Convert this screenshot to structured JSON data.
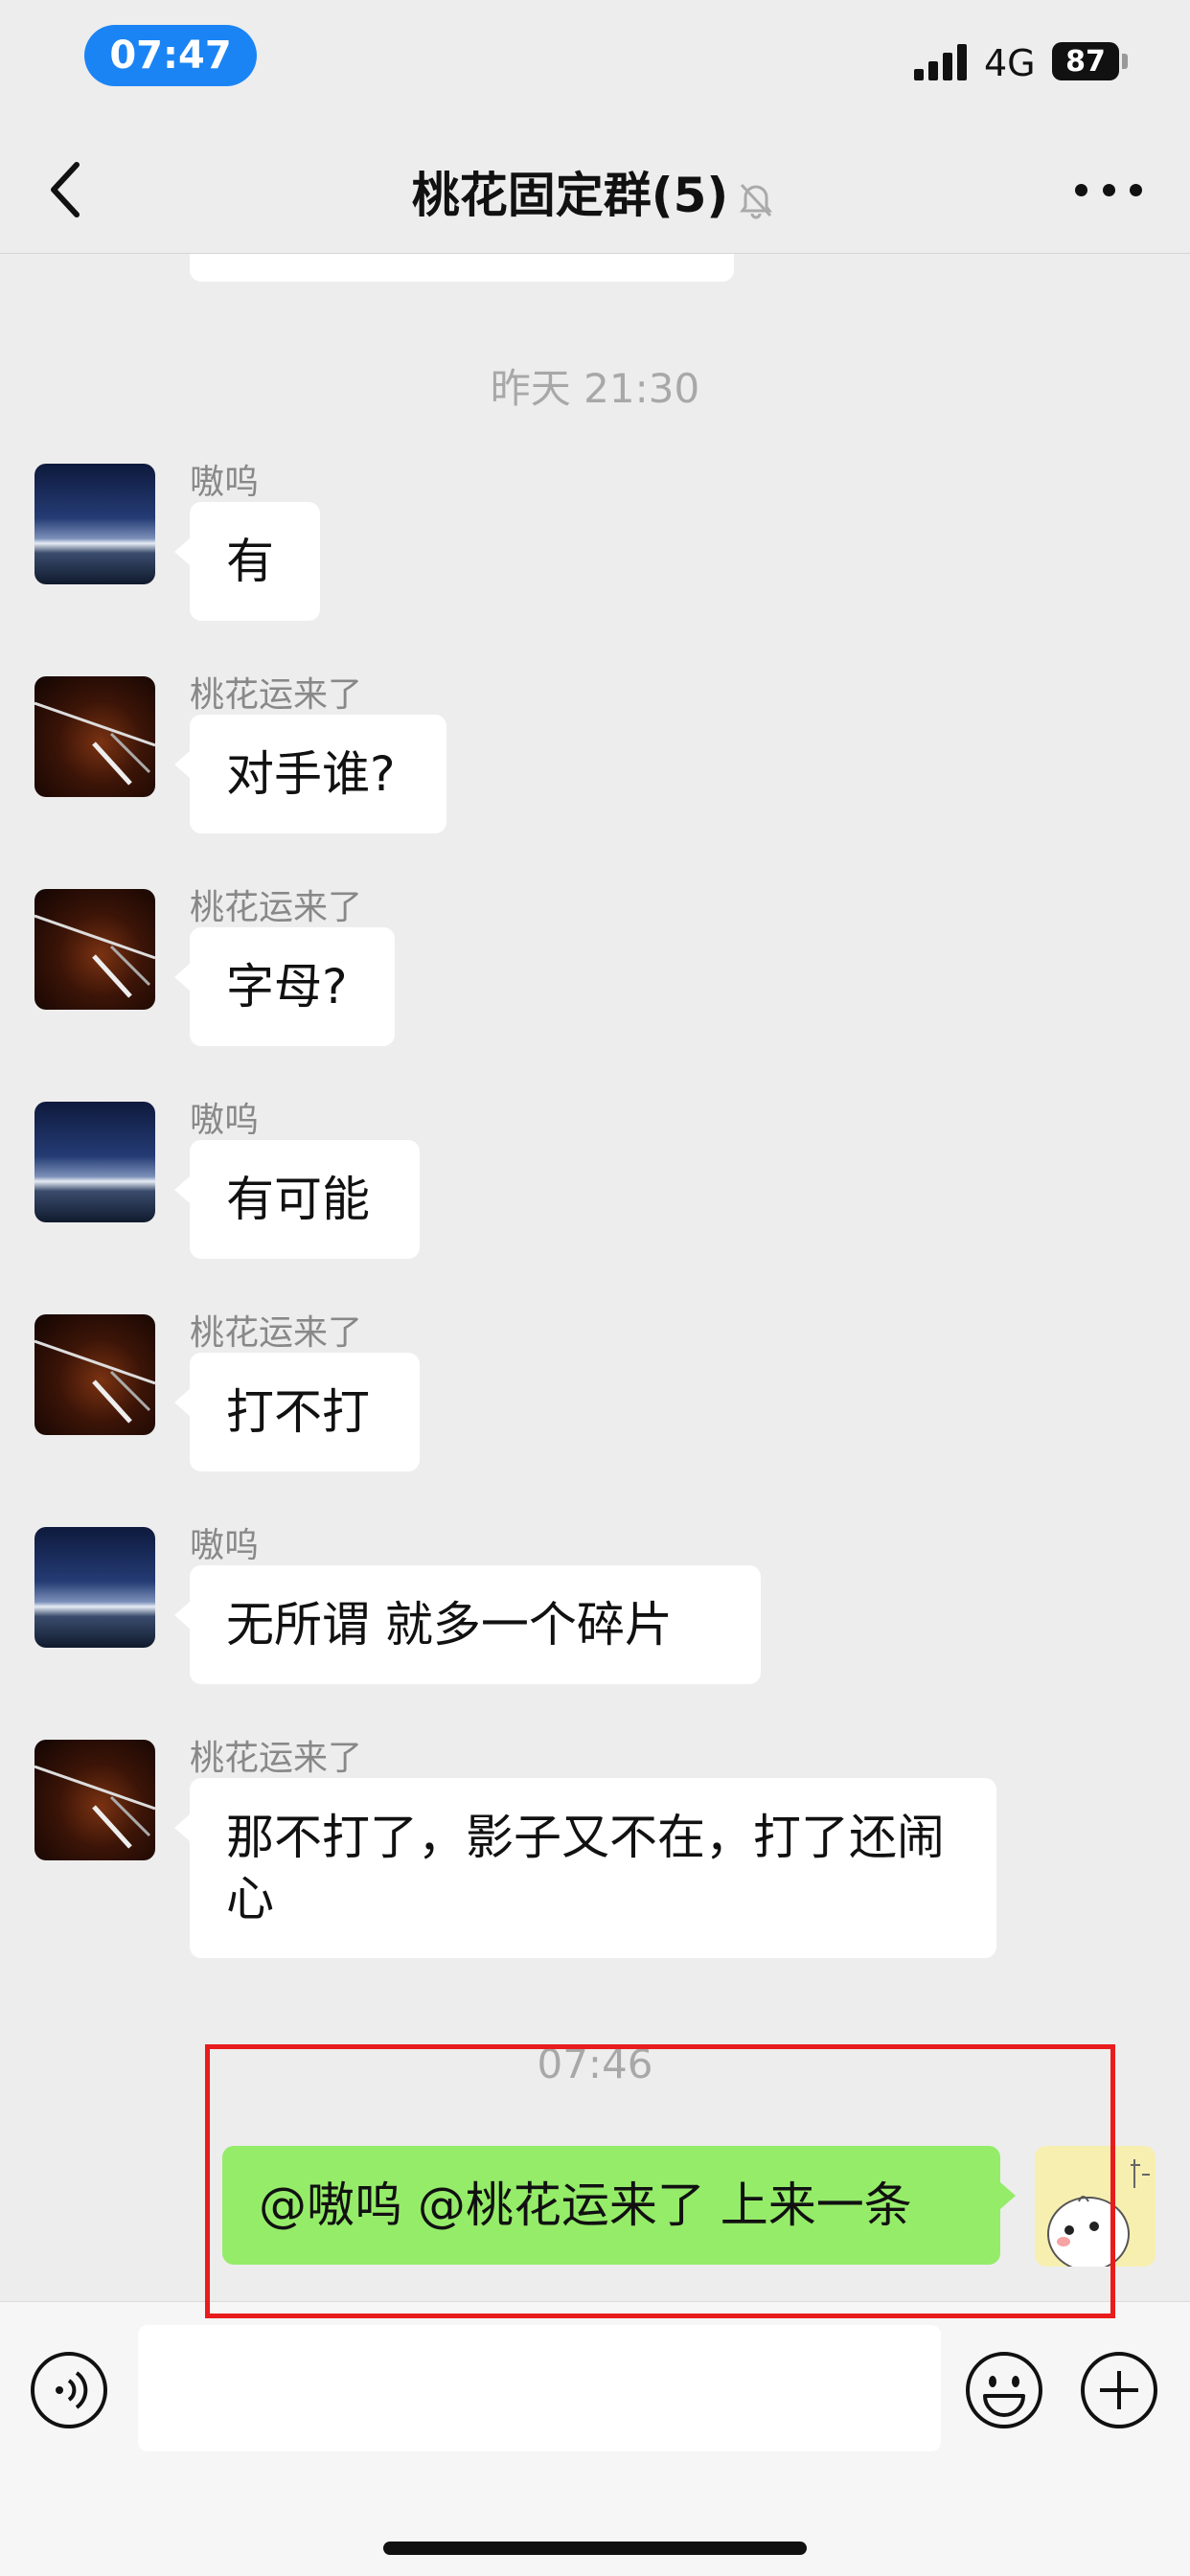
{
  "status_bar": {
    "time": "07:47",
    "network": "4G",
    "battery": "87"
  },
  "nav": {
    "title": "桃花固定群(5)",
    "icons": [
      "back-icon",
      "mute-bell-icon",
      "more-icon"
    ]
  },
  "messages": {
    "timestamp_1": "昨天 21:30",
    "items": [
      {
        "sender": "嗷呜",
        "avatar": "starry-sky",
        "text": "有"
      },
      {
        "sender": "桃花运来了",
        "avatar": "violin",
        "text": "对手谁?"
      },
      {
        "sender": "桃花运来了",
        "avatar": "violin",
        "text": "字母?"
      },
      {
        "sender": "嗷呜",
        "avatar": "starry-sky",
        "text": "有可能"
      },
      {
        "sender": "桃花运来了",
        "avatar": "violin",
        "text": "打不打"
      },
      {
        "sender": "嗷呜",
        "avatar": "starry-sky",
        "text": "无所谓 就多一个碎片"
      },
      {
        "sender": "桃花运来了",
        "avatar": "violin",
        "text": "那不打了，影子又不在，打了还闹心"
      }
    ],
    "timestamp_2": "07:46",
    "own_message": {
      "text": "@嗷呜 @桃花运来了 上来一条",
      "avatar": "cartoon-chick"
    }
  },
  "input_bar": {
    "icons": [
      "voice-icon",
      "emoji-icon",
      "plus-icon"
    ],
    "placeholder": ""
  },
  "colors": {
    "background": "#ededed",
    "own_bubble": "#95ec69",
    "other_bubble": "#ffffff",
    "time_pill": "#1a84f5",
    "highlight": "#e81c1c"
  }
}
